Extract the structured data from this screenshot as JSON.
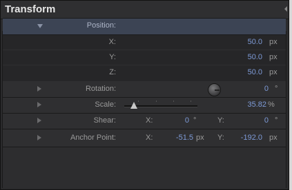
{
  "panel": {
    "title": "Transform"
  },
  "position": {
    "label": "Position:",
    "x": {
      "label": "X:",
      "value": "50.0",
      "unit": "px"
    },
    "y": {
      "label": "Y:",
      "value": "50.0",
      "unit": "px"
    },
    "z": {
      "label": "Z:",
      "value": "50.0",
      "unit": "px"
    }
  },
  "rotation": {
    "label": "Rotation:",
    "value": "0",
    "unit": "°"
  },
  "scale": {
    "label": "Scale:",
    "value": "35.82",
    "unit": "%",
    "slider_fraction": 0.13
  },
  "shear": {
    "label": "Shear:",
    "x_label": "X:",
    "x_value": "0",
    "x_unit": "°",
    "y_label": "Y:",
    "y_value": "0",
    "y_unit": "°"
  },
  "anchor_point": {
    "label": "Anchor Point:",
    "x_label": "X:",
    "x_value": "-51.5",
    "x_unit": "px",
    "y_label": "Y:",
    "y_value": "-192.0",
    "y_unit": "px"
  },
  "colors": {
    "accent_value": "#7e9bd8",
    "selected_row": "#3c4454"
  }
}
